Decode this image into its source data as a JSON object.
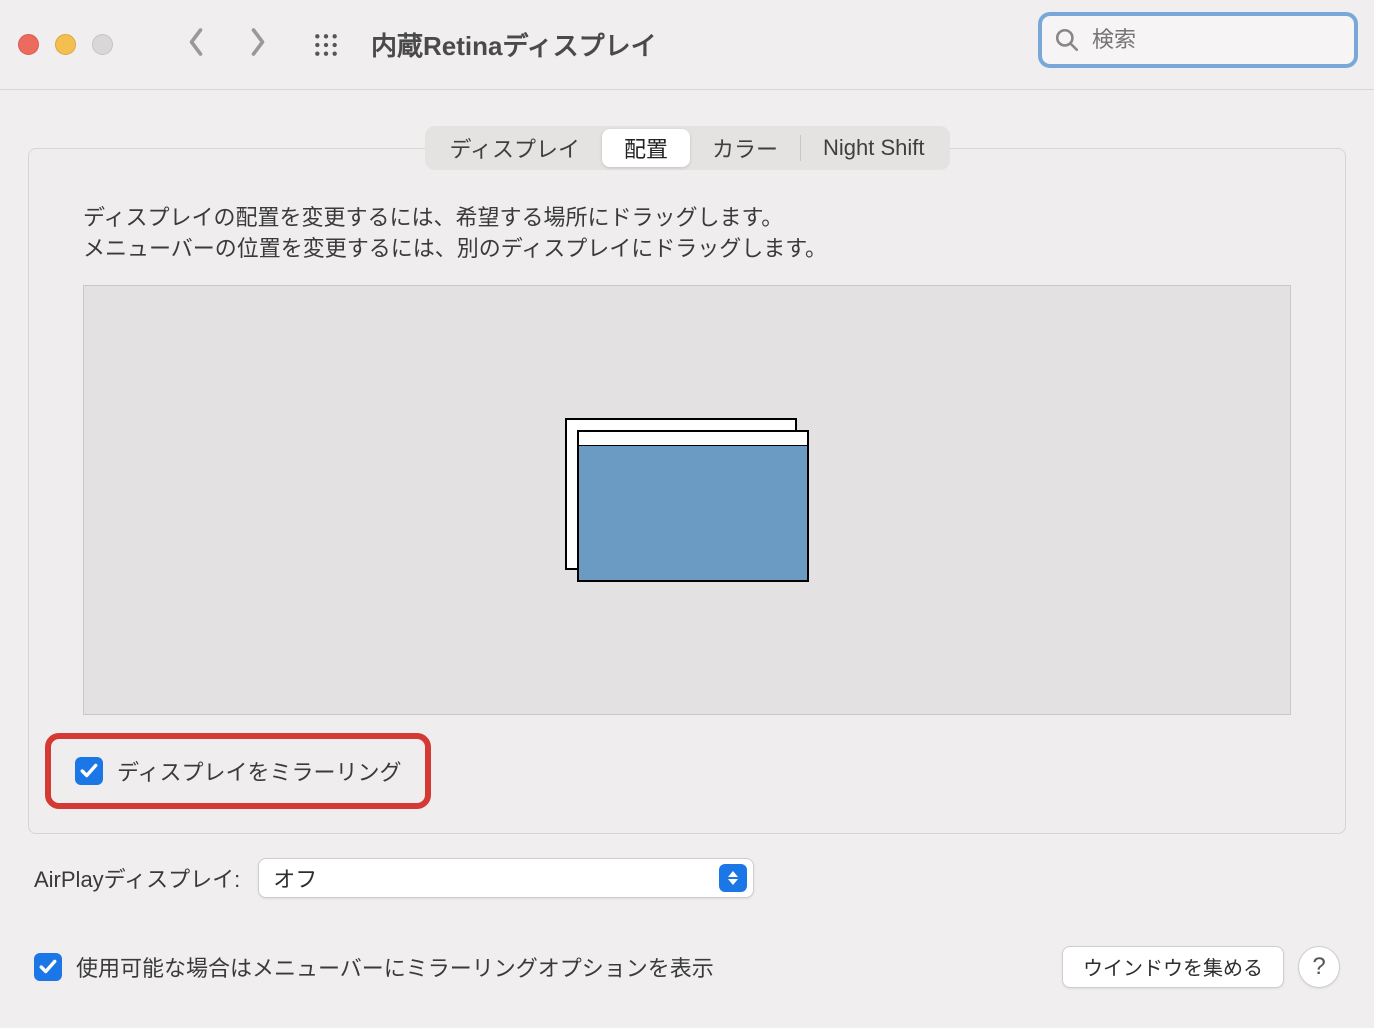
{
  "header": {
    "title": "内蔵Retinaディスプレイ",
    "search_placeholder": "検索"
  },
  "tabs": {
    "display": "ディスプレイ",
    "arrangement": "配置",
    "color": "カラー",
    "night_shift": "Night Shift",
    "active": "arrangement"
  },
  "panel": {
    "instruction_line1": "ディスプレイの配置を変更するには、希望する場所にドラッグします。",
    "instruction_line2": "メニューバーの位置を変更するには、別のディスプレイにドラッグします。",
    "mirror_checkbox_label": "ディスプレイをミラーリング",
    "mirror_checkbox_checked": true
  },
  "airplay": {
    "label": "AirPlayディスプレイ:",
    "value": "オフ"
  },
  "menubar_option": {
    "label": "使用可能な場合はメニューバーにミラーリングオプションを表示",
    "checked": true
  },
  "buttons": {
    "gather_windows": "ウインドウを集める",
    "help": "?"
  },
  "colors": {
    "accent": "#1a77e5",
    "highlight_ring": "#d33a34",
    "focus_ring": "#7aa7d9",
    "display_fill": "#6b9bc3"
  }
}
